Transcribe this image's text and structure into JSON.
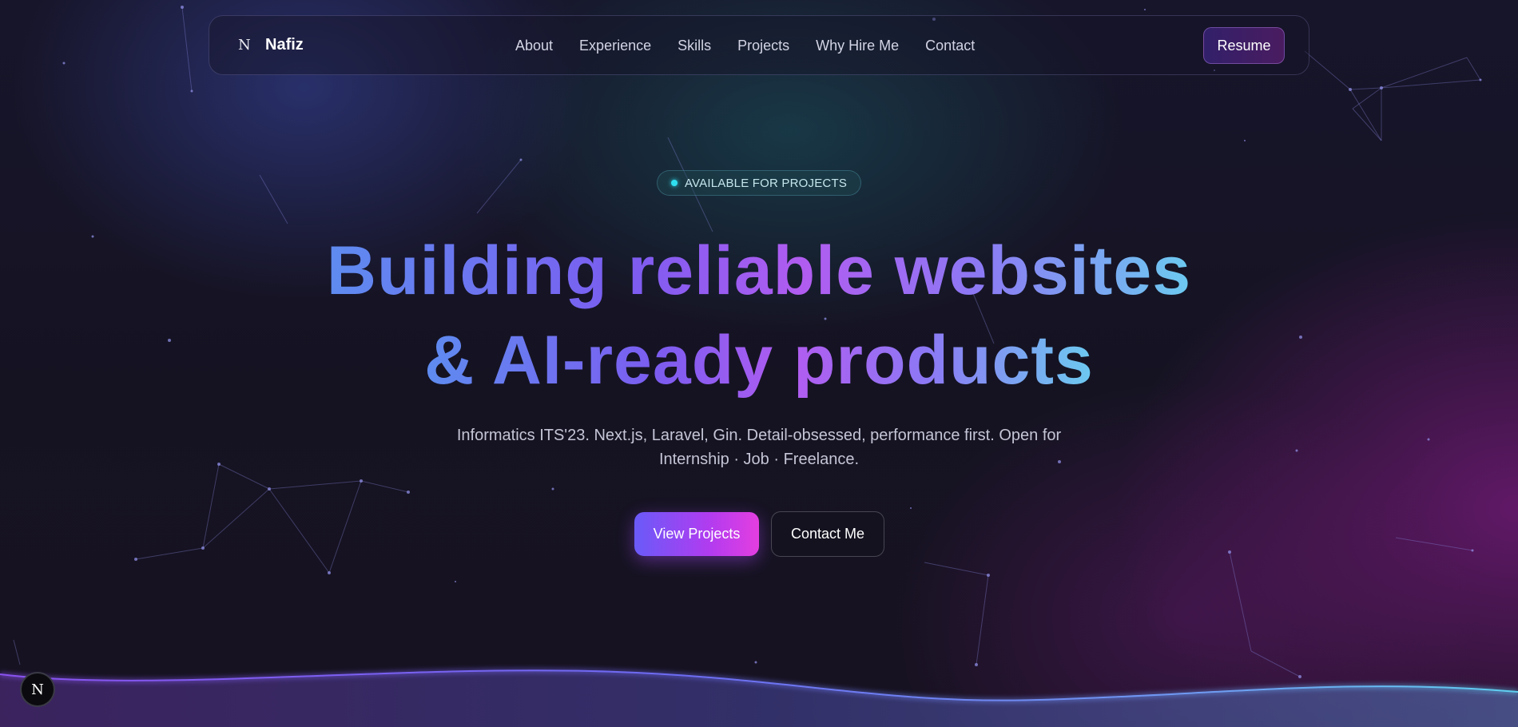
{
  "nav": {
    "brand_icon": "N",
    "brand_name": "Nafiz",
    "links": [
      "About",
      "Experience",
      "Skills",
      "Projects",
      "Why Hire Me",
      "Contact"
    ],
    "resume_label": "Resume"
  },
  "hero": {
    "badge_text": "AVAILABLE FOR PROJECTS",
    "headline_line1": "Building reliable websites",
    "headline_line2": "& AI-ready products",
    "subtitle_line1": "Informatics ITS'23. Next.js, Laravel, Gin. Detail-obsessed, performance first. Open for",
    "subtitle_line2": "Internship · Job · Freelance.",
    "primary_button": "View Projects",
    "secondary_button": "Contact Me"
  },
  "corner_badge": {
    "label": "N"
  },
  "colors": {
    "accent_blue": "#5e8cf0",
    "accent_purple": "#b15cf0",
    "accent_pink": "#e43ee0",
    "badge_dot": "#2fe0f0"
  }
}
